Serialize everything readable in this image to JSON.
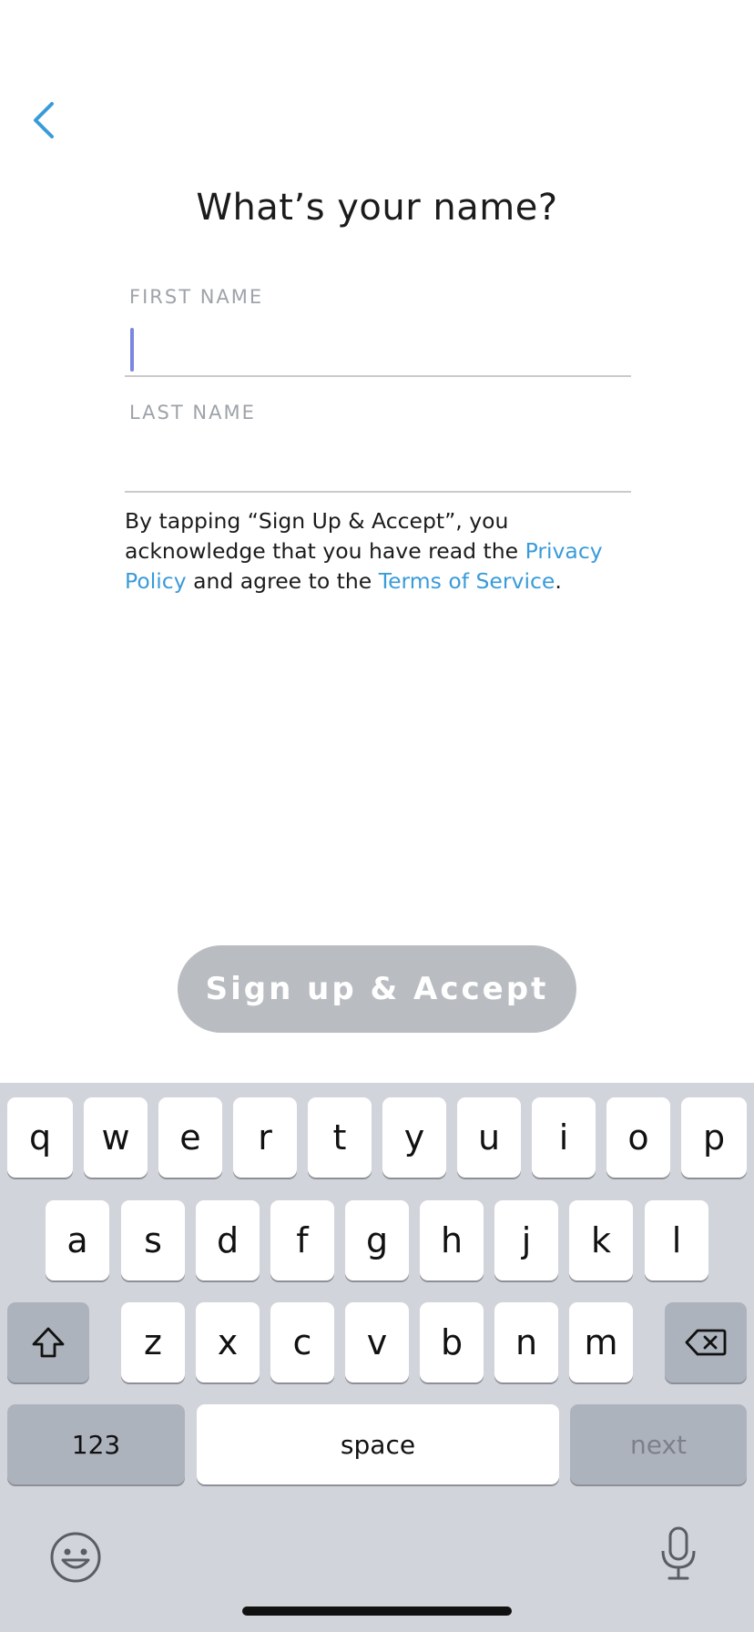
{
  "title": "What’s your name?",
  "first_name": {
    "label": "FIRST NAME",
    "value": ""
  },
  "last_name": {
    "label": "LAST NAME",
    "value": ""
  },
  "legal": {
    "part1": "By tapping “Sign Up & Accept”, you acknowledge that you have read the ",
    "privacy_link": "Privacy Policy",
    "part2": " and agree to the ",
    "terms_link": "Terms of Service",
    "part3": "."
  },
  "signup_button": "Sign up & Accept",
  "keyboard": {
    "row1": [
      "q",
      "w",
      "e",
      "r",
      "t",
      "y",
      "u",
      "i",
      "o",
      "p"
    ],
    "row2": [
      "a",
      "s",
      "d",
      "f",
      "g",
      "h",
      "j",
      "k",
      "l"
    ],
    "row3": [
      "z",
      "x",
      "c",
      "v",
      "b",
      "n",
      "m"
    ],
    "numbers_key": "123",
    "space_key": "space",
    "next_key": "next"
  },
  "colors": {
    "accent": "#3a9bd9",
    "caret": "#7b86e0",
    "button_disabled": "#b9bdc2",
    "keyboard_bg": "#d1d4da"
  },
  "icons": {
    "back": "chevron-left-icon",
    "shift": "shift-icon",
    "delete": "backspace-icon",
    "emoji": "emoji-icon",
    "mic": "microphone-icon"
  }
}
